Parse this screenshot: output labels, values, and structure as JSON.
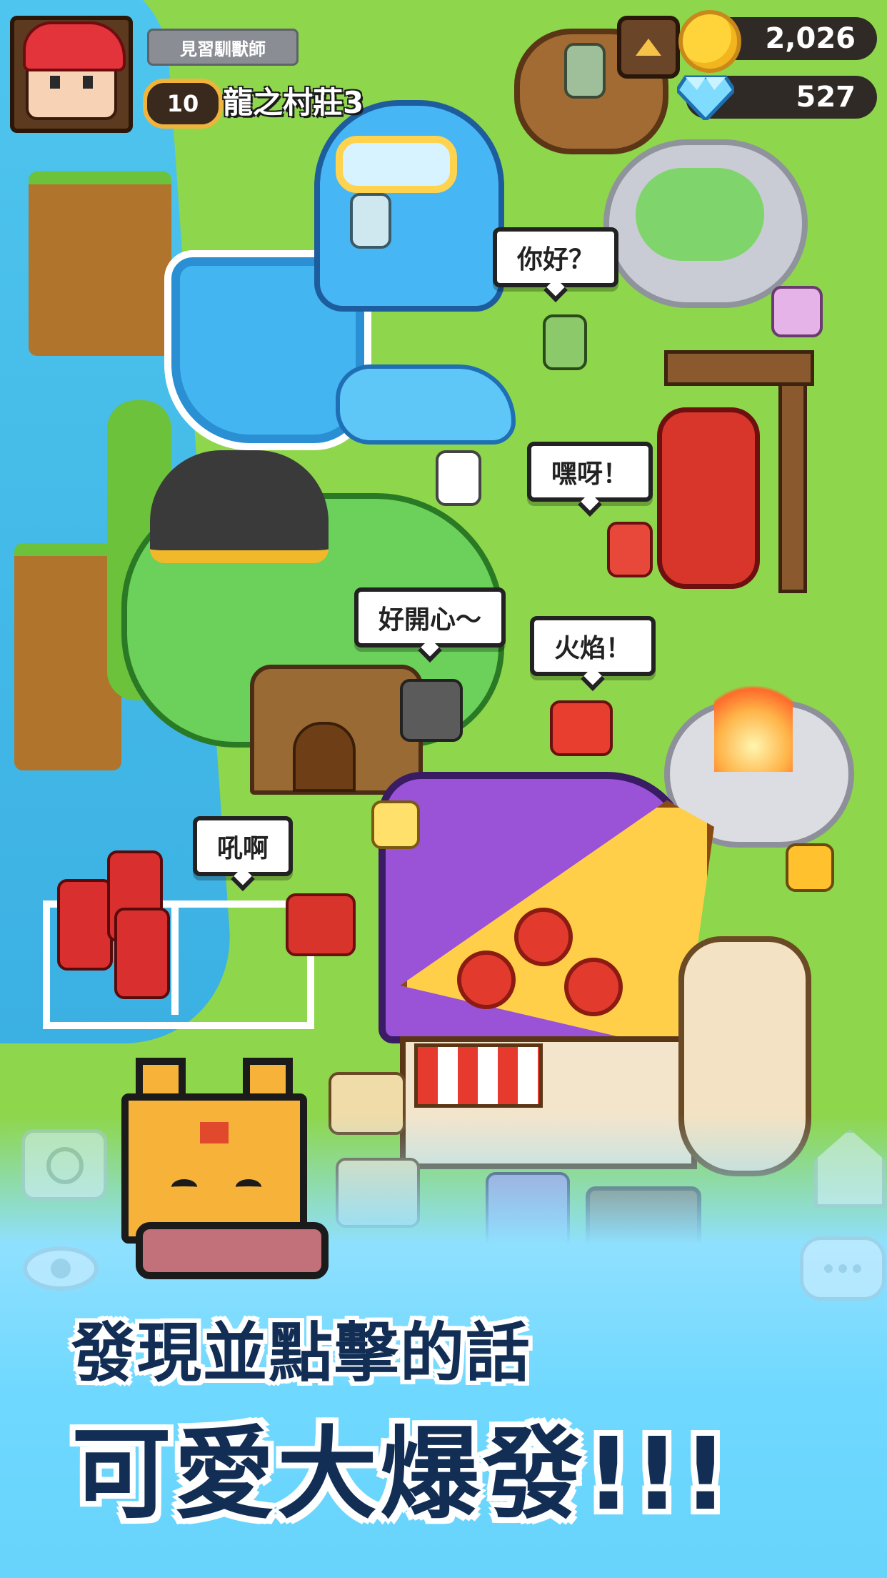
{
  "player": {
    "title": "見習馴獸師",
    "level": "10",
    "village_name": "龍之村莊3"
  },
  "currency": {
    "coins": "2,026",
    "gems": "527"
  },
  "bubbles": {
    "hello": "你好？",
    "heya": "嘿呀！",
    "happy": "好開心～",
    "flame": "火焰！",
    "roar": "吼啊"
  },
  "promo": {
    "line1": "發現並點擊的話",
    "line2": "可愛大爆發!!!"
  },
  "icons": [
    "avatar",
    "menu-triangle-icon",
    "coin-icon",
    "gem-icon",
    "camera-icon",
    "eye-icon",
    "home-icon",
    "chat-icon"
  ],
  "colors": {
    "grass": "#8ed64b",
    "water": "#43b6f2",
    "promo_text": "#132e55",
    "promo_bg": "#6fd8ff"
  }
}
